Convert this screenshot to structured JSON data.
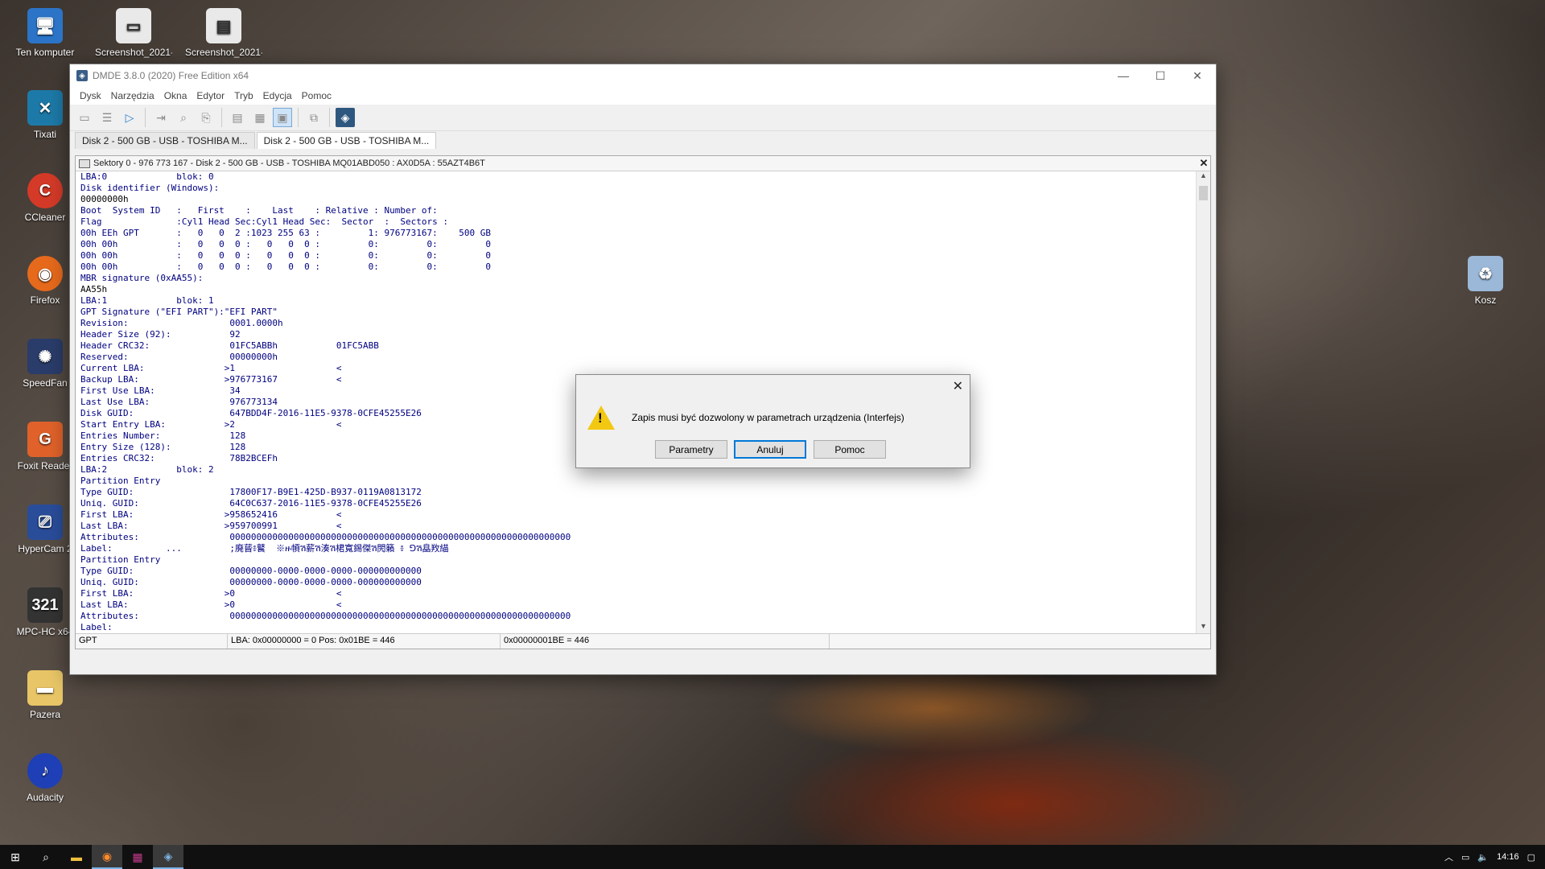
{
  "desktop": {
    "icons": [
      {
        "label": "Ten komputer",
        "icon": "computer-icon",
        "color": "#2b74c7"
      },
      {
        "label": "Screenshot_2021-...",
        "icon": "image-file-icon",
        "color": "#e9e9e9"
      },
      {
        "label": "Screenshot_2021-...",
        "icon": "image-file-icon",
        "color": "#e9e9e9"
      },
      {
        "label": "Tixati",
        "icon": "tixati-icon",
        "color": "#1d7aa8"
      },
      {
        "label": "CCleaner",
        "icon": "ccleaner-icon",
        "color": "#d53a28"
      },
      {
        "label": "Firefox",
        "icon": "firefox-icon",
        "color": "#e76a1c"
      },
      {
        "label": "SpeedFan",
        "icon": "speedfan-icon",
        "color": "#2a3c6a"
      },
      {
        "label": "Foxit Reader",
        "icon": "foxit-icon",
        "color": "#e0622a"
      },
      {
        "label": "HyperCam 2",
        "icon": "hypercam-icon",
        "color": "#2a4d9a"
      },
      {
        "label": "MPC-HC x64",
        "icon": "mpc-icon",
        "color": "#333333"
      },
      {
        "label": "Pazera",
        "icon": "folder-icon",
        "color": "#e8c566"
      },
      {
        "label": "Audacity",
        "icon": "audacity-icon",
        "color": "#1e3fb5"
      },
      {
        "label": "Kosz",
        "icon": "recycle-bin-icon",
        "color": "#9bb8d8"
      }
    ]
  },
  "window": {
    "title": "DMDE 3.8.0 (2020) Free Edition x64",
    "menu": [
      "Dysk",
      "Narzędzia",
      "Okna",
      "Edytor",
      "Tryb",
      "Edycja",
      "Pomoc"
    ],
    "tabs": [
      "Disk 2 - 500 GB - USB - TOSHIBA M...",
      "Disk 2 - 500 GB - USB - TOSHIBA M..."
    ],
    "panel_title": "Sektory 0 - 976 773 167 - Disk 2 - 500 GB - USB - TOSHIBA MQ01ABD050 : AX0D5A : 55AZT4B6T",
    "lines": [
      "LBA:0             blok: 0",
      "Disk identifier (Windows):",
      "00000000h",
      "Boot  System ID   :   First    :    Last    : Relative : Number of:",
      "Flag              :Cyl1 Head Sec:Cyl1 Head Sec:  Sector  :  Sectors :",
      "00h EEh GPT       :   0   0  2 :1023 255 63 :         1: 976773167:    500 GB",
      "00h 00h           :   0   0  0 :   0   0  0 :         0:         0:         0",
      "00h 00h           :   0   0  0 :   0   0  0 :         0:         0:         0",
      "00h 00h           :   0   0  0 :   0   0  0 :         0:         0:         0",
      "MBR signature (0xAA55):",
      "AA55h",
      "LBA:1             blok: 1",
      "GPT Signature (\"EFI PART\"):\"EFI PART\"",
      "Revision:                   0001.0000h",
      "Header Size (92):           92",
      "Header CRC32:               01FC5ABBh           01FC5ABB",
      "Reserved:                   00000000h",
      "Current LBA:               >1                   <",
      "Backup LBA:                >976773167           <",
      "First Use LBA:              34",
      "Last Use LBA:               976773134",
      "Disk GUID:                  647BDD4F-2016-11E5-9378-0CFE45255E26",
      "Start Entry LBA:           >2                   <",
      "Entries Number:             128",
      "Entry Size (128):           128",
      "Entries CRC32:              78B2BCEFh",
      "LBA:2             blok: 2",
      "Partition Entry",
      "Type GUID:                  17800F17-B9E1-425D-B937-0119A0813172",
      "Uniq. GUID:                 64C0C637-2016-11E5-9378-0CFE45255E26",
      "First LBA:                 >958652416           <",
      "Last LBA:                  >959700991           <",
      "Attributes:                 0000000000000000000000000000000000000000000000000000000000000000",
      "Label:          ...         ;廃蒈៖鼚  ※ዙ幁ሽ薪ሽ湊ሽ桾寬錫傑ሽ閌籟 ៖ ⅁ሽ皛䍩緢",
      "Partition Entry",
      "Type GUID:                  00000000-0000-0000-0000-000000000000",
      "Uniq. GUID:                 00000000-0000-0000-0000-000000000000",
      "First LBA:                 >0                   <",
      "Last LBA:                  >0                   <",
      "Attributes:                 0000000000000000000000000000000000000000000000000000000000000000",
      "Label:"
    ],
    "status": [
      "GPT",
      "LBA: 0x00000000 = 0  Pos: 0x01BE = 446",
      "0x00000001BE = 446"
    ]
  },
  "dialog": {
    "message": "Zapis musi być dozwolony w parametrach urządzenia (Interfejs)",
    "buttons": [
      "Parametry",
      "Anuluj",
      "Pomoc"
    ]
  },
  "taskbar": {
    "time": "14:16",
    "items": [
      "start-icon",
      "search-icon",
      "file-explorer-icon",
      "firefox-icon",
      "winrar-icon",
      "dmde-icon"
    ]
  }
}
